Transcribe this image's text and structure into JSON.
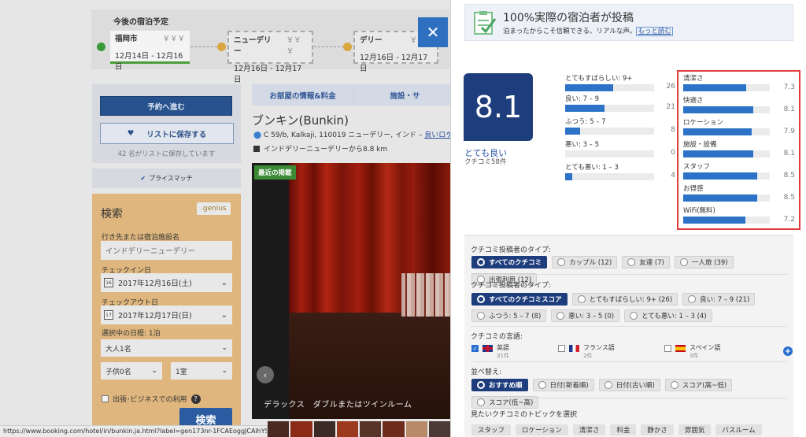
{
  "trip": {
    "title": "今後の宿泊予定",
    "legs": [
      {
        "city": "福岡市",
        "price": "￥￥￥",
        "dates": "12月14日 - 12月16日"
      },
      {
        "city": "ニューデリー",
        "price": "￥￥￥",
        "dates": "12月16日 - 12月17日"
      },
      {
        "city": "デリー",
        "price": "￥￥￥",
        "dates": "12月16日 - 12月17日"
      }
    ]
  },
  "sidebar": {
    "reserve_label": "予約へ進む",
    "save_label": "リストに保存する",
    "saved_count": "42 名がリストに保存しています",
    "price_match": "プライスマッチ"
  },
  "search": {
    "title": "検索",
    "genius": ".genius",
    "dest_label": "行き先または宿泊施設名",
    "dest_value": "インドデリーニューデリー",
    "checkin_label": "チェックイン日",
    "checkin_day": "16",
    "checkin_value": "2017年12月16日(土)",
    "checkout_label": "チェックアウト日",
    "checkout_day": "17",
    "checkout_value": "2017年12月17日(日)",
    "nights": "選択中の日程: 1泊",
    "adults": "大人1名",
    "children": "子供0名",
    "rooms": "1室",
    "business": "出張･ビジネスでの利用",
    "submit": "検索"
  },
  "hotel": {
    "tabs": [
      "お部屋の情報&料金",
      "施設・サ"
    ],
    "name": "ブンキン(Bunkin)",
    "address": "C 59/b, Kalkaji, 110019 ニューデリー, インド – ",
    "address_link": "良いロケー",
    "distance": "インドデリーニューデリーから8.8 km",
    "badge": "最近の掲載",
    "caption": "デラックス　ダブルまたはツインルーム",
    "url": "https://www.booking.com/hotel/in/bunkin.ja.html?label=gen173nr-1FCAEoggJCAlhYSDNYB"
  },
  "reviews": {
    "banner_title": "100%実際の宿泊者が投稿",
    "banner_text": "泊まったからこそ信頼できる、リアルな声。",
    "banner_more": "もっと読む",
    "score": "8.1",
    "score_label": "とても良い",
    "review_count": "クチコミ58件",
    "breakdown": [
      {
        "label": "とてもすばらしい: 9+",
        "count": "26",
        "fraction": 0.54
      },
      {
        "label": "良い: 7 – 9",
        "count": "21",
        "fraction": 0.44
      },
      {
        "label": "ふつう: 5 – 7",
        "count": "8",
        "fraction": 0.17
      },
      {
        "label": "悪い: 3 – 5",
        "count": "0",
        "fraction": 0.0
      },
      {
        "label": "とても悪い: 1 – 3",
        "count": "4",
        "fraction": 0.08
      }
    ],
    "categories": [
      {
        "label": "清潔さ",
        "score": "7.3",
        "fraction": 0.73
      },
      {
        "label": "快適さ",
        "score": "8.1",
        "fraction": 0.81
      },
      {
        "label": "ロケーション",
        "score": "7.9",
        "fraction": 0.79
      },
      {
        "label": "施設・設備",
        "score": "8.1",
        "fraction": 0.81
      },
      {
        "label": "スタッフ",
        "score": "8.5",
        "fraction": 0.85
      },
      {
        "label": "お得感",
        "score": "8.5",
        "fraction": 0.85
      },
      {
        "label": "WiFi(無料)",
        "score": "7.2",
        "fraction": 0.72
      }
    ]
  },
  "filters": {
    "reviewer_type_label": "クチコミ投稿者のタイプ:",
    "reviewer_types": [
      "すべてのクチコミ",
      "カップル (12)",
      "友達 (7)",
      "一人旅 (39)",
      "出張利用 (12)"
    ],
    "score_type_label": "クチコミ投稿者のタイプ:",
    "score_types": [
      "すべてのクチコミスコア",
      "とてもすばらしい: 9+ (26)",
      "良い: 7 – 9 (21)",
      "ふつう: 5 – 7 (8)",
      "悪い: 3 – 5 (0)",
      "とても悪い: 1 – 3 (4)"
    ],
    "language_label": "クチコミの言語:",
    "languages": [
      {
        "name": "英語",
        "count": "31件"
      },
      {
        "name": "フランス語",
        "count": "2件"
      },
      {
        "name": "スペイン語",
        "count": "3件"
      }
    ],
    "sort_label": "並べ替え:",
    "sorts": [
      "おすすめ順",
      "日付(新着順)",
      "日付(古い順)",
      "スコア(高~低)",
      "スコア(低~高)"
    ],
    "topics_label": "見たいクチコミのトピックを選択",
    "topics": [
      "スタッフ",
      "ロケーション",
      "清潔さ",
      "料金",
      "静かさ",
      "雰囲気",
      "バスルーム"
    ]
  },
  "colors": {
    "brand_blue": "#1d3d7c",
    "bar_blue": "#2c73c8",
    "highlight_red": "#e33b3b",
    "genius_orange": "#dfb77e"
  }
}
